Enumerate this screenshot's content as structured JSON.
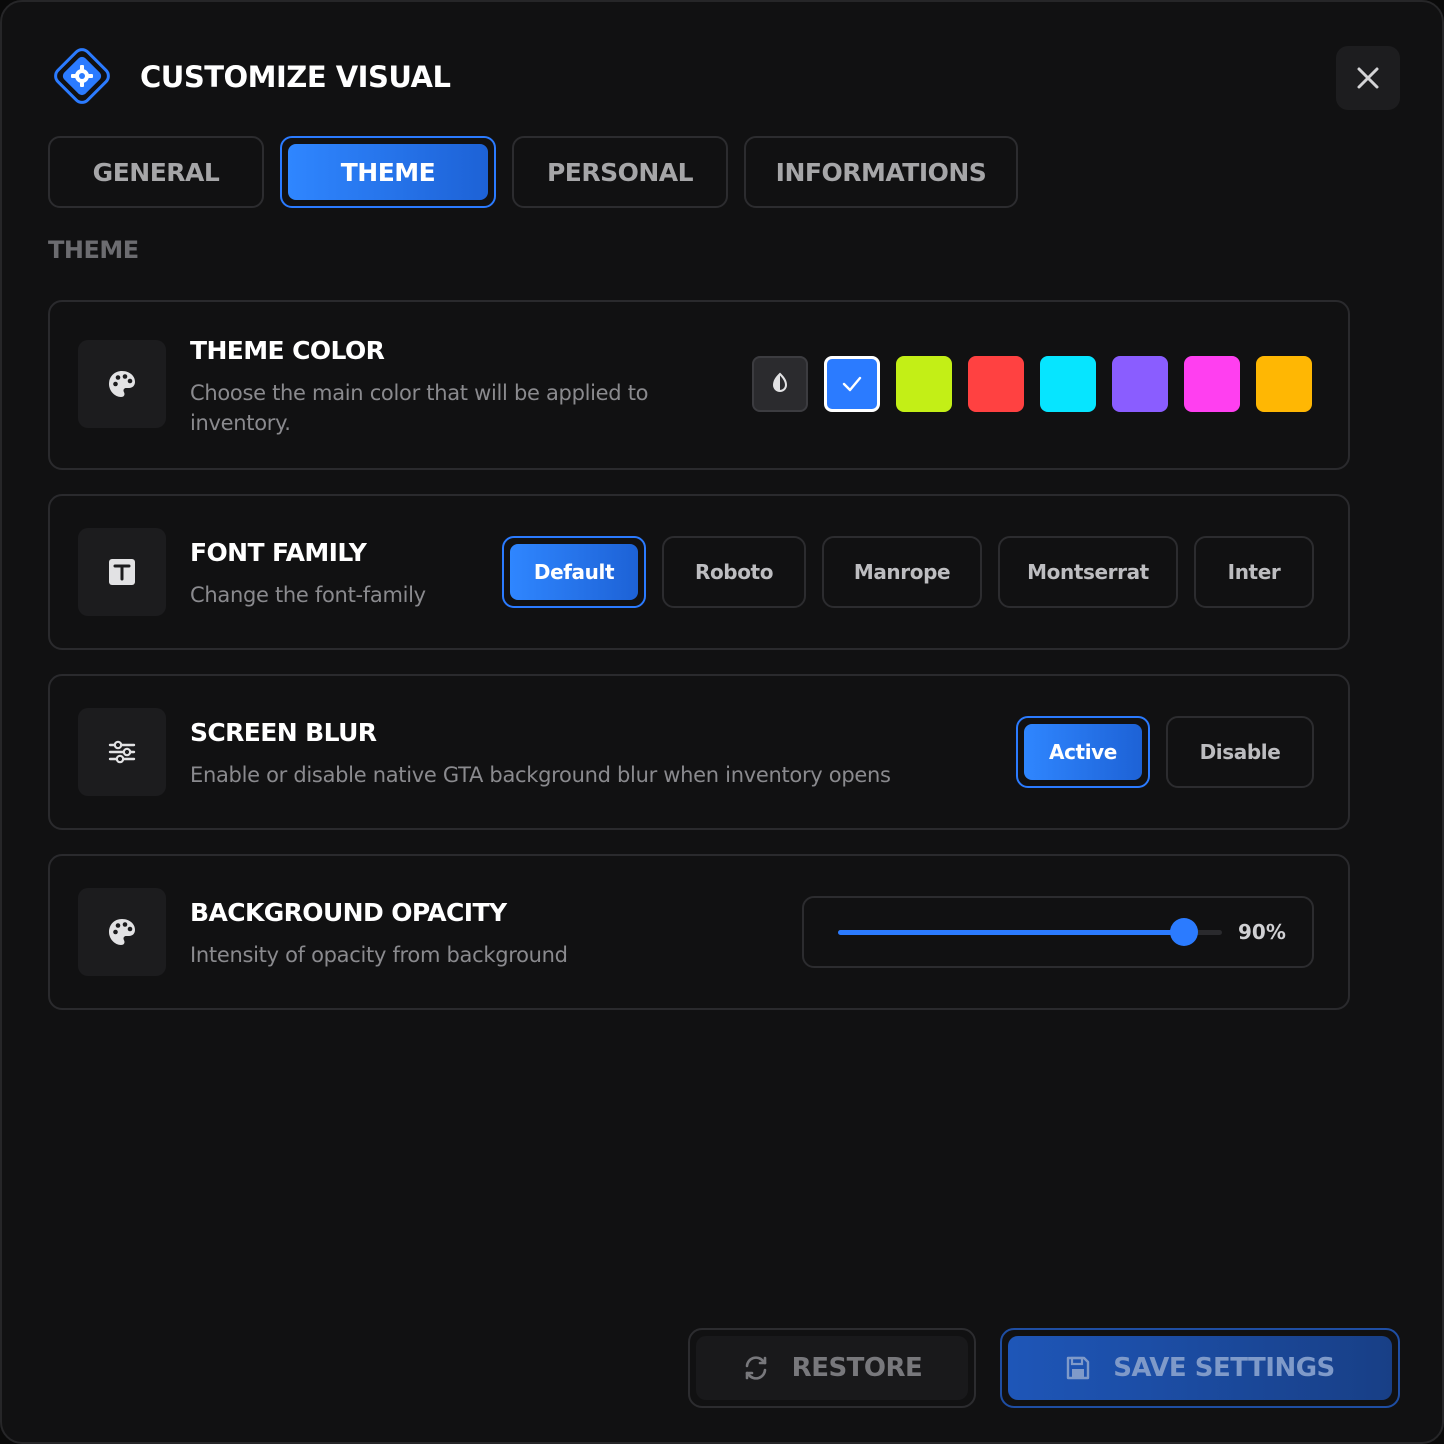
{
  "header": {
    "title": "CUSTOMIZE VISUAL",
    "logo_icon": "gear-icon",
    "close_icon": "close-icon"
  },
  "tabs": [
    {
      "label": "GENERAL",
      "active": false
    },
    {
      "label": "THEME",
      "active": true
    },
    {
      "label": "PERSONAL",
      "active": false
    },
    {
      "label": "INFORMATIONS",
      "active": false
    }
  ],
  "section_label": "THEME",
  "theme_color": {
    "title": "THEME COLOR",
    "description": "Choose the main color that will be applied to inventory.",
    "icon": "palette-icon",
    "swatches": [
      {
        "name": "contrast",
        "color": "#2b2b2e",
        "selected": false
      },
      {
        "name": "blue",
        "color": "#2b7bff",
        "selected": true
      },
      {
        "name": "lime",
        "color": "#c3ef16",
        "selected": false
      },
      {
        "name": "red",
        "color": "#ff4141",
        "selected": false
      },
      {
        "name": "cyan",
        "color": "#06e5ff",
        "selected": false
      },
      {
        "name": "purple",
        "color": "#8a5dff",
        "selected": false
      },
      {
        "name": "magenta",
        "color": "#ff3ff0",
        "selected": false
      },
      {
        "name": "amber",
        "color": "#ffb703",
        "selected": false
      }
    ]
  },
  "font_family": {
    "title": "FONT FAMILY",
    "description": "Change the font-family",
    "icon": "text-icon",
    "options": [
      "Default",
      "Roboto",
      "Manrope",
      "Montserrat",
      "Inter"
    ],
    "selected": "Default"
  },
  "screen_blur": {
    "title": "SCREEN BLUR",
    "description": "Enable or disable native GTA background blur when inventory opens",
    "icon": "sliders-icon",
    "options": [
      "Active",
      "Disable"
    ],
    "selected": "Active"
  },
  "background_opacity": {
    "title": "BACKGROUND OPACITY",
    "description": "Intensity of opacity from background",
    "icon": "palette-icon",
    "value": 90,
    "value_label": "90%"
  },
  "footer": {
    "restore_label": "RESTORE",
    "restore_icon": "refresh-icon",
    "save_label": "SAVE SETTINGS",
    "save_icon": "floppy-disk-icon"
  },
  "colors": {
    "accent": "#2b7bff",
    "background": "#111112",
    "border": "#2a2a2d"
  }
}
